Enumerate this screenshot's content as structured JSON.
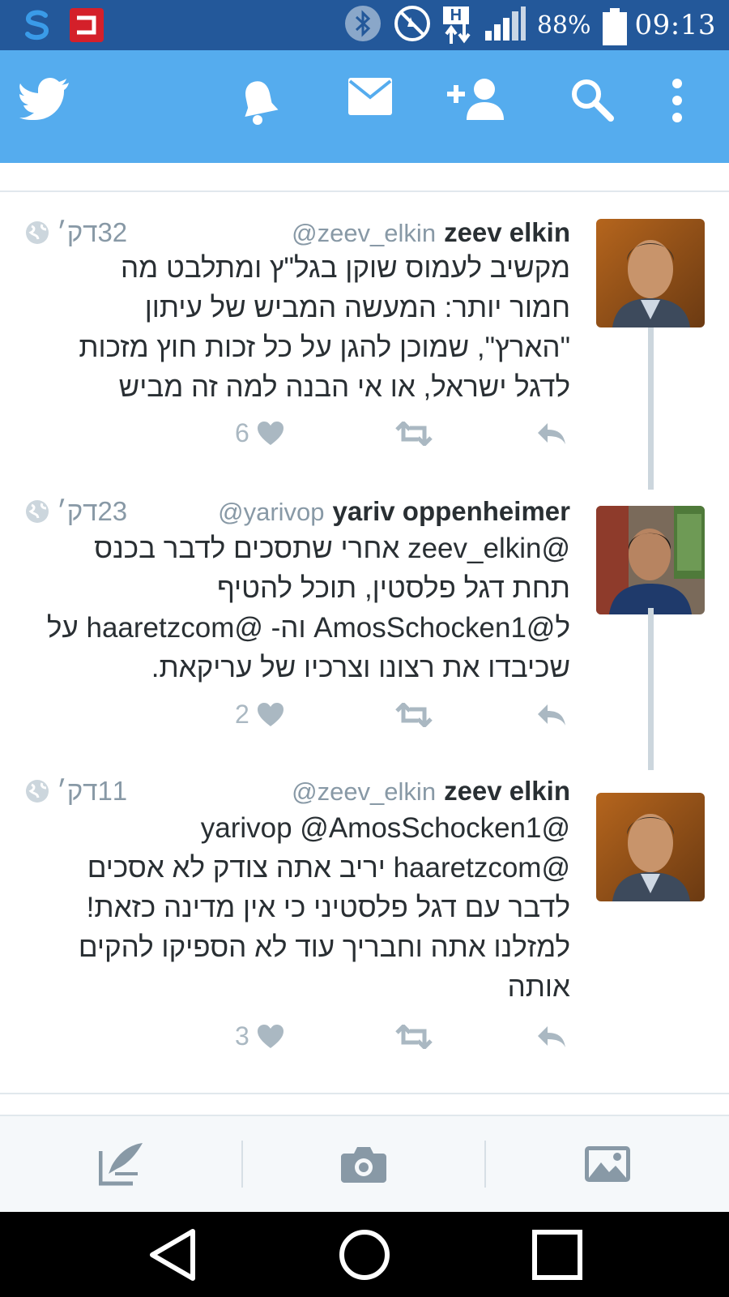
{
  "status_bar": {
    "battery_pct": "88%",
    "time": "09:13",
    "network_label": "H"
  },
  "colors": {
    "twitter_blue": "#55acee",
    "status_bar": "#23589a",
    "muted": "#8899a6",
    "action": "#aab8c2"
  },
  "top_bar": {
    "icons": [
      "twitter-bird-icon",
      "bell-icon",
      "messages-icon",
      "add-user-icon",
      "search-icon",
      "overflow-menu-icon"
    ]
  },
  "tweets": [
    {
      "name": "zeev elkin",
      "handle": "@zeev_elkin",
      "time": "32דק׳",
      "lines": [
        "מקשיב לעמוס שוקן בגל\"ץ ומתלבט מה",
        "חמור יותר: המעשה המביש של עיתון",
        "\"הארץ\", שמוכן להגן על כל זכות חוץ מזכות",
        "לדגל ישראל, או אי הבנה למה זה מביש"
      ],
      "likes": "6"
    },
    {
      "name": "yariv oppenheimer",
      "handle": "@yarivop",
      "time": "23דק׳",
      "lines": [
        "@zeev_elkin אחרי שתסכים לדבר בכנס",
        "תחת דגל פלסטין, תוכל להטיף",
        "ל@AmosSchocken1 וה- @haaretzcom על",
        "שכיבדו את רצונו וצרכיו של עריקאת."
      ],
      "likes": "2"
    },
    {
      "name": "zeev elkin",
      "handle": "@zeev_elkin",
      "time": "11דק׳",
      "lines": [
        "@yarivop @AmosSchocken1",
        "@haaretzcom יריב אתה צודק לא אסכים",
        "לדבר עם דגל פלסטיני כי אין מדינה כזאת!",
        "למזלנו אתה וחבריך עוד לא הספיקו להקים",
        "אותה"
      ],
      "likes": "3"
    }
  ],
  "compose_bar": {
    "icons": [
      "compose-tweet-icon",
      "camera-icon",
      "gallery-icon"
    ]
  },
  "nav_bar": {
    "icons": [
      "back-icon",
      "home-icon",
      "recents-icon"
    ]
  }
}
